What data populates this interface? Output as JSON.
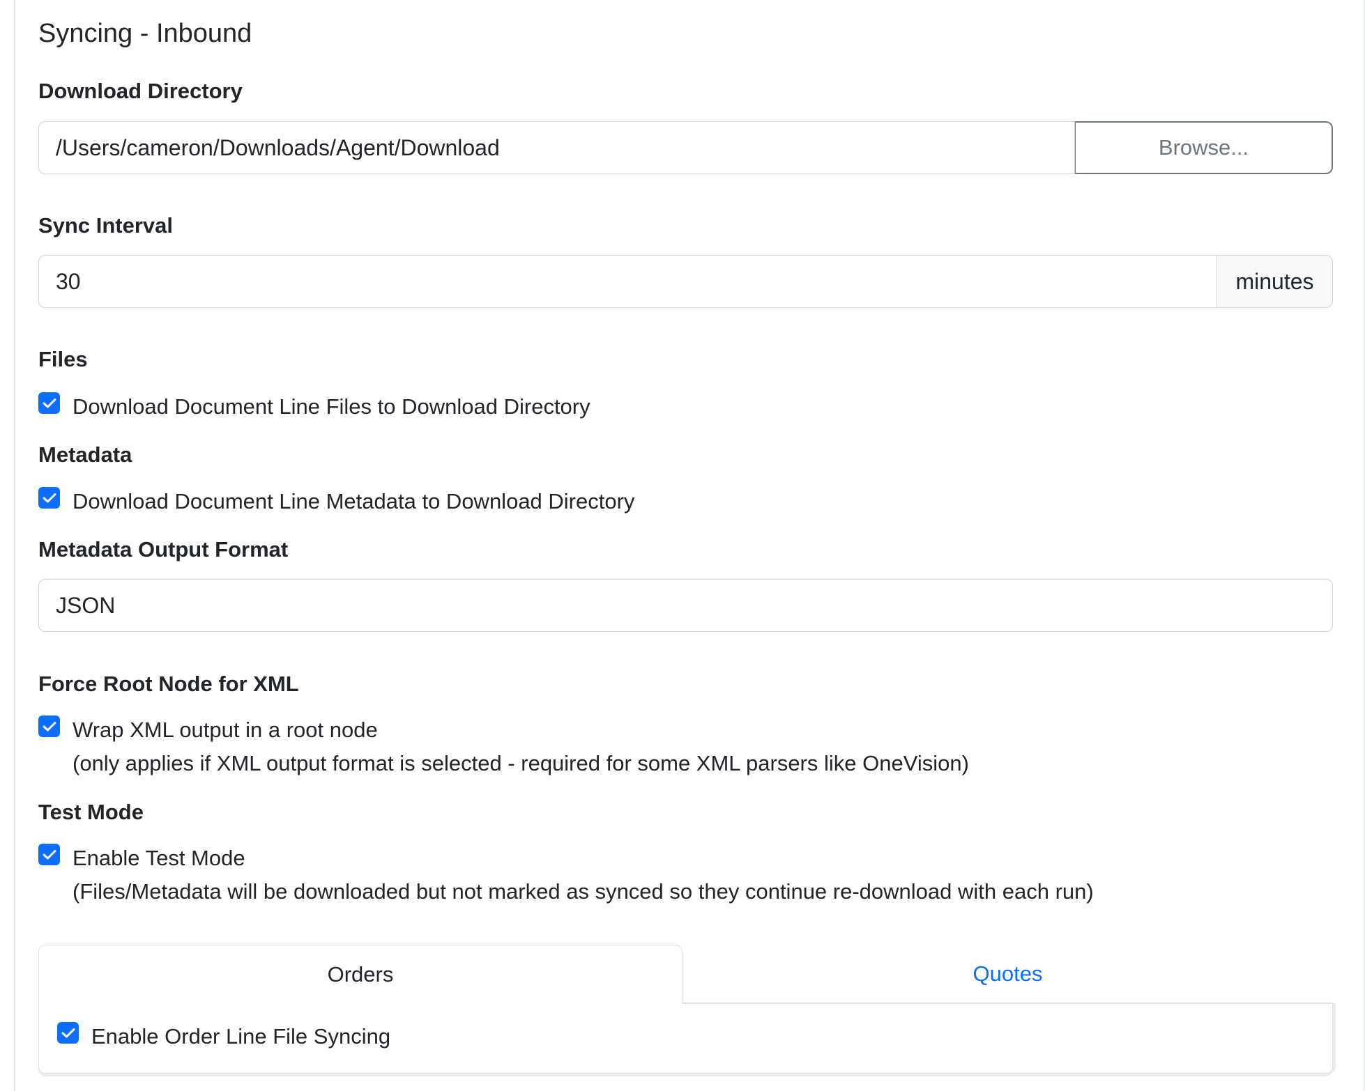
{
  "section": {
    "title": "Syncing - Inbound"
  },
  "download_directory": {
    "label": "Download Directory",
    "value": "/Users/cameron/Downloads/Agent/Download",
    "browse_label": "Browse..."
  },
  "sync_interval": {
    "label": "Sync Interval",
    "value": "30",
    "unit": "minutes"
  },
  "files": {
    "label": "Files",
    "checkbox_label": "Download Document Line Files to Download Directory",
    "checked": true
  },
  "metadata": {
    "label": "Metadata",
    "checkbox_label": "Download Document Line Metadata to Download Directory",
    "checked": true
  },
  "metadata_output_format": {
    "label": "Metadata Output Format",
    "value": "JSON"
  },
  "force_root_node": {
    "label": "Force Root Node for XML",
    "checkbox_label": "Wrap XML output in a root node",
    "note": "(only applies if XML output format is selected - required for some XML parsers like OneVision)",
    "checked": true
  },
  "test_mode": {
    "label": "Test Mode",
    "checkbox_label": "Enable Test Mode",
    "note": "(Files/Metadata will be downloaded but not marked as synced so they continue re-download with each run)",
    "checked": true
  },
  "tabs": {
    "items": [
      {
        "label": "Orders",
        "active": true
      },
      {
        "label": "Quotes",
        "active": false
      }
    ],
    "orders_panel": {
      "checkbox_label": "Enable Order Line File Syncing",
      "checked": true
    }
  },
  "colors": {
    "accent": "#0d6efd",
    "text": "#212529",
    "muted": "#6c757d",
    "border": "#ced4da"
  }
}
